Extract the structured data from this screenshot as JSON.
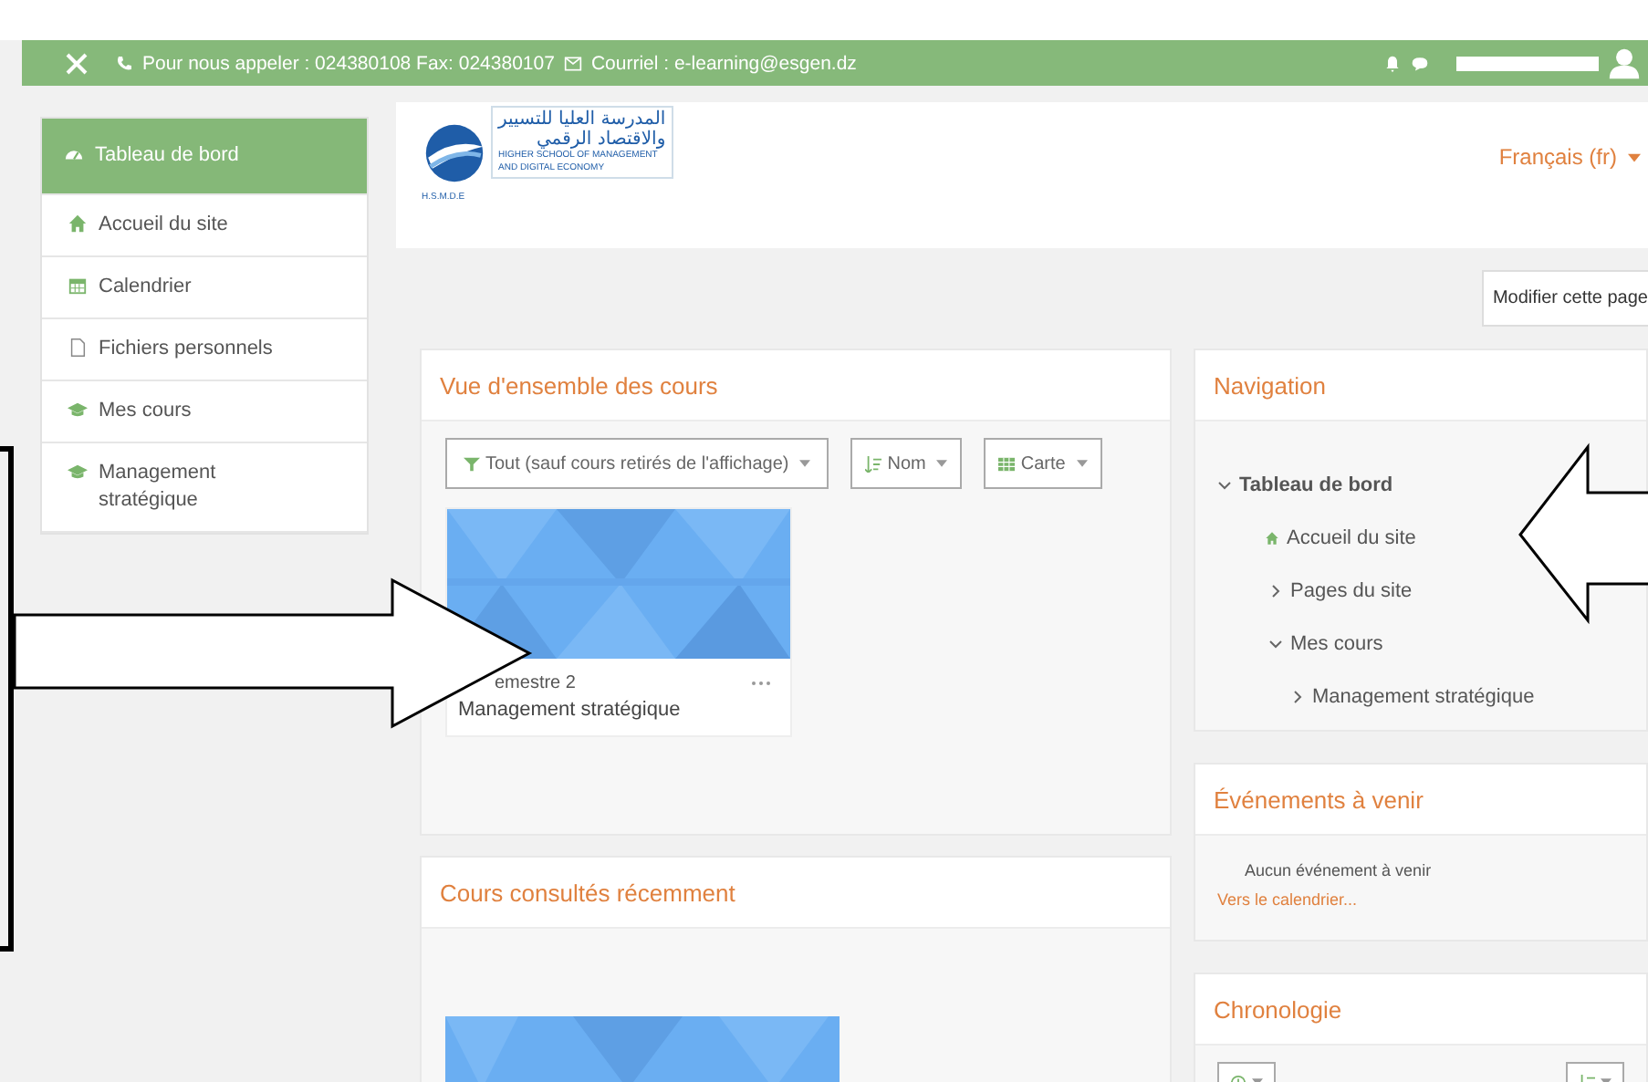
{
  "navbar": {
    "contact": "Pour nous appeler : 024380108 Fax: 024380107",
    "email": "Courriel : e-learning@esgen.dz"
  },
  "sidebar": {
    "items": [
      {
        "label": "Tableau de bord",
        "kind": "dashboard",
        "selected": true
      },
      {
        "label": "Accueil du site",
        "kind": "home",
        "selected": false
      },
      {
        "label": "Calendrier",
        "kind": "calendar",
        "selected": false
      },
      {
        "label": "Fichiers personnels",
        "kind": "file",
        "selected": false
      },
      {
        "label": "Mes cours",
        "kind": "course",
        "selected": false
      },
      {
        "label": "Management stratégique",
        "kind": "course",
        "selected": false
      }
    ]
  },
  "header": {
    "logo_arabic": [
      "المدرسة العليا للتسيير",
      "والاقتصاد الرقمي"
    ],
    "logo_english": [
      "HIGHER SCHOOL OF MANAGEMENT",
      "AND DIGITAL ECONOMY"
    ],
    "logo_acronym": "H.S.M.D.E",
    "language": "Français (fr)"
  },
  "edit_button": "Modifier cette page",
  "course_overview": {
    "title": "Vue d'ensemble des cours",
    "filter": "Tout (sauf cours retirés de l'affichage)",
    "sort": "Nom",
    "view": "Carte",
    "courses": [
      {
        "category": "emestre 2",
        "name": "Management stratégique"
      }
    ]
  },
  "recent": {
    "title": "Cours consultés récemment"
  },
  "navigation": {
    "title": "Navigation",
    "tree": [
      {
        "label": "Tableau de bord",
        "kind": "branch",
        "expanded": true,
        "children": [
          {
            "label": "Accueil du site",
            "kind": "home"
          },
          {
            "label": "Pages du site",
            "kind": "branch",
            "expanded": false
          },
          {
            "label": "Mes cours",
            "kind": "branch",
            "expanded": true,
            "children": [
              {
                "label": "Management stratégique",
                "kind": "branch",
                "expanded": false
              }
            ]
          }
        ]
      }
    ]
  },
  "events": {
    "title": "Événements à venir",
    "empty": "Aucun événement à venir",
    "link": "Vers le calendrier..."
  },
  "timeline": {
    "title": "Chronologie"
  }
}
